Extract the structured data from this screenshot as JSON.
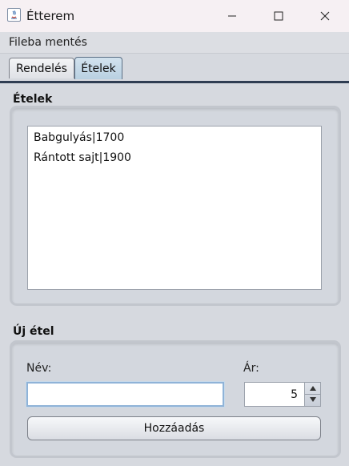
{
  "window": {
    "title": "Étterem"
  },
  "menu": {
    "file_label": "Fileba mentés"
  },
  "tabs": [
    {
      "label": "Rendelés",
      "selected": false
    },
    {
      "label": "Ételek",
      "selected": true
    }
  ],
  "foods_section": {
    "title": "Ételek",
    "items": [
      "Babgulyás|1700",
      "Rántott sajt|1900"
    ]
  },
  "new_food_section": {
    "title": "Új étel",
    "name_label": "Név:",
    "name_value": "",
    "price_label": "Ár:",
    "price_value": "5",
    "add_button": "Hozzáadás"
  },
  "colors": {
    "tab_selected": "#b9d0e1",
    "tab_line": "#2f3d52",
    "input_focus": "#8fb3d8"
  }
}
